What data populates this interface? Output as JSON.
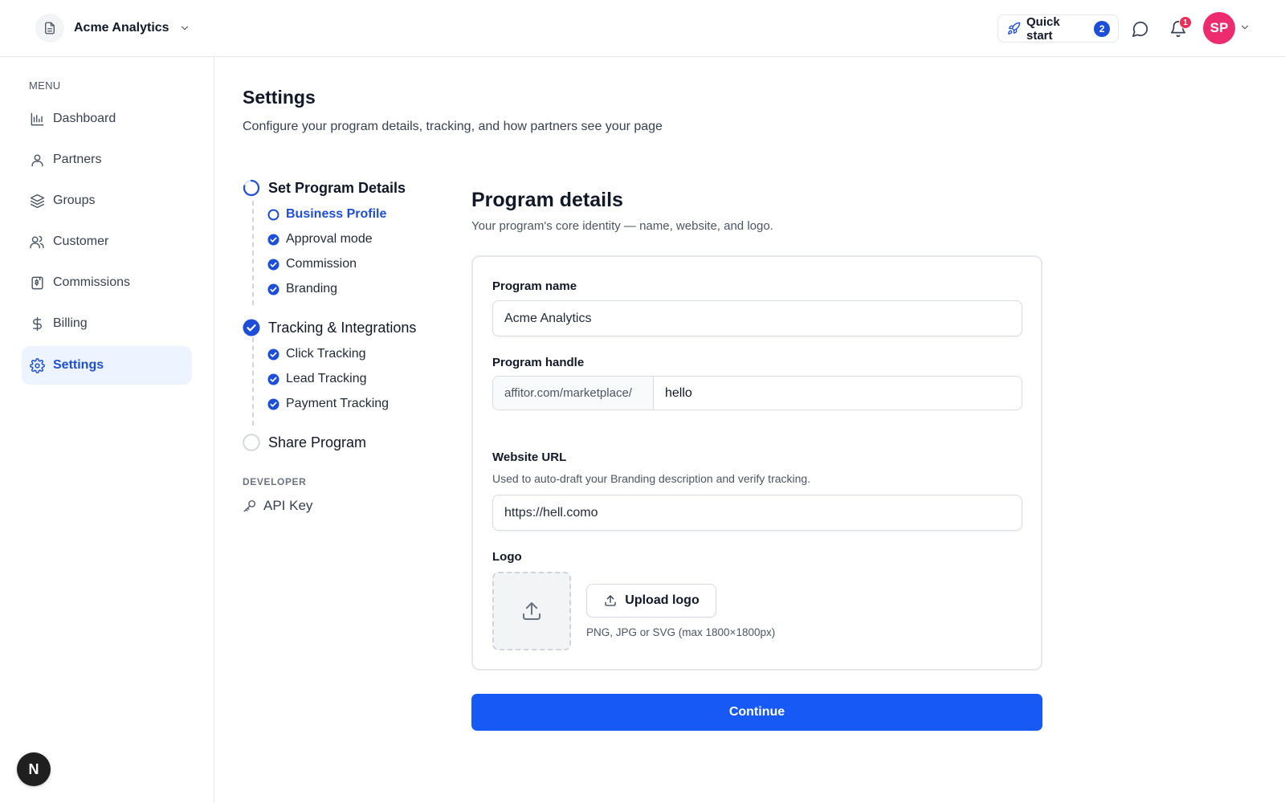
{
  "workspace": {
    "name": "Acme Analytics",
    "icon": "document-icon"
  },
  "topbar": {
    "quick_start_label": "Quick start",
    "quick_start_badge": "2",
    "notifications_badge": "1",
    "avatar_initials": "SP"
  },
  "sidebar": {
    "menu_label": "MENU",
    "items": [
      {
        "label": "Dashboard",
        "icon": "bar-chart-icon"
      },
      {
        "label": "Partners",
        "icon": "user-icon"
      },
      {
        "label": "Groups",
        "icon": "layers-icon"
      },
      {
        "label": "Customer",
        "icon": "users-icon"
      },
      {
        "label": "Commissions",
        "icon": "receipt-icon"
      },
      {
        "label": "Billing",
        "icon": "dollar-icon"
      },
      {
        "label": "Settings",
        "icon": "gear-icon",
        "active": true
      }
    ],
    "logo_letter": "N"
  },
  "page": {
    "title": "Settings",
    "subtitle": "Configure your program details, tracking, and how partners see your page"
  },
  "steps": {
    "groups": [
      {
        "label": "Set Program Details",
        "status": "in-progress",
        "items": [
          {
            "label": "Business Profile",
            "status": "current"
          },
          {
            "label": "Approval mode",
            "status": "done"
          },
          {
            "label": "Commission",
            "status": "done"
          },
          {
            "label": "Branding",
            "status": "done"
          }
        ]
      },
      {
        "label": "Tracking & Integrations",
        "status": "done",
        "items": [
          {
            "label": "Click Tracking",
            "status": "done"
          },
          {
            "label": "Lead Tracking",
            "status": "done"
          },
          {
            "label": "Payment Tracking",
            "status": "done"
          }
        ]
      },
      {
        "label": "Share Program",
        "status": "pending",
        "items": []
      }
    ],
    "developer_label": "DEVELOPER",
    "api_key_label": "API Key"
  },
  "form": {
    "title": "Program details",
    "subtitle": "Your program's core identity — name, website, and logo.",
    "program_name": {
      "label": "Program name",
      "value": "Acme Analytics"
    },
    "program_handle": {
      "label": "Program handle",
      "prefix": "affitor.com/marketplace/",
      "value": "hello"
    },
    "website_url": {
      "label": "Website URL",
      "help": "Used to auto-draft your Branding description and verify tracking.",
      "value": "https://hell.como"
    },
    "logo": {
      "label": "Logo",
      "upload_label": "Upload logo",
      "help": "PNG, JPG or SVG (max 1800×1800px)"
    },
    "continue_label": "Continue"
  },
  "colors": {
    "accent": "#1659f5",
    "active_nav_bg": "#eef4ff",
    "avatar": "#ec2c6e",
    "badge_red": "#ef2d56"
  }
}
